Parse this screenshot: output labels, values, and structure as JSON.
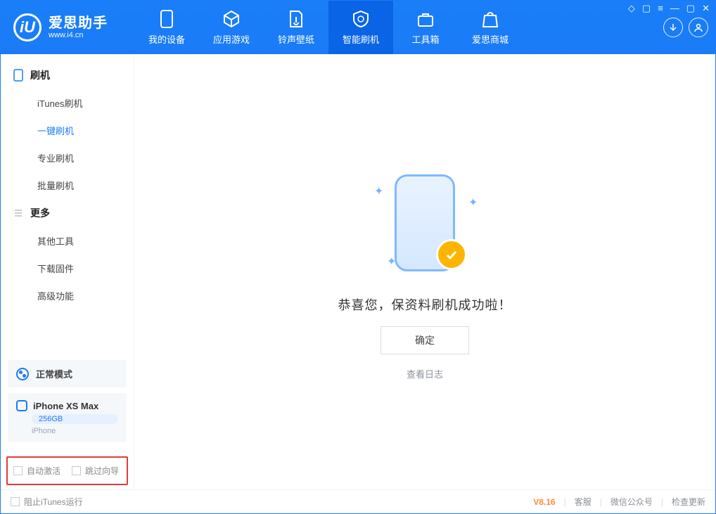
{
  "brand": {
    "cn": "爱思助手",
    "url": "www.i4.cn",
    "logo_letter": "iU"
  },
  "tabs": [
    {
      "label": "我的设备"
    },
    {
      "label": "应用游戏"
    },
    {
      "label": "铃声壁纸"
    },
    {
      "label": "智能刷机"
    },
    {
      "label": "工具箱"
    },
    {
      "label": "爱思商城"
    }
  ],
  "sidebar": {
    "section1_title": "刷机",
    "items1": [
      {
        "label": "iTunes刷机"
      },
      {
        "label": "一键刷机"
      },
      {
        "label": "专业刷机"
      },
      {
        "label": "批量刷机"
      }
    ],
    "section2_title": "更多",
    "items2": [
      {
        "label": "其他工具"
      },
      {
        "label": "下载固件"
      },
      {
        "label": "高级功能"
      }
    ]
  },
  "mode": {
    "label": "正常模式"
  },
  "device": {
    "name": "iPhone XS Max",
    "capacity": "256GB",
    "type": "iPhone"
  },
  "options": {
    "auto_activate": "自动激活",
    "skip_guide": "跳过向导"
  },
  "main": {
    "message": "恭喜您，保资料刷机成功啦！",
    "ok": "确定",
    "view_log": "查看日志"
  },
  "status": {
    "block_itunes": "阻止iTunes运行",
    "version": "V8.16",
    "links": [
      "客服",
      "微信公众号",
      "检查更新"
    ]
  }
}
